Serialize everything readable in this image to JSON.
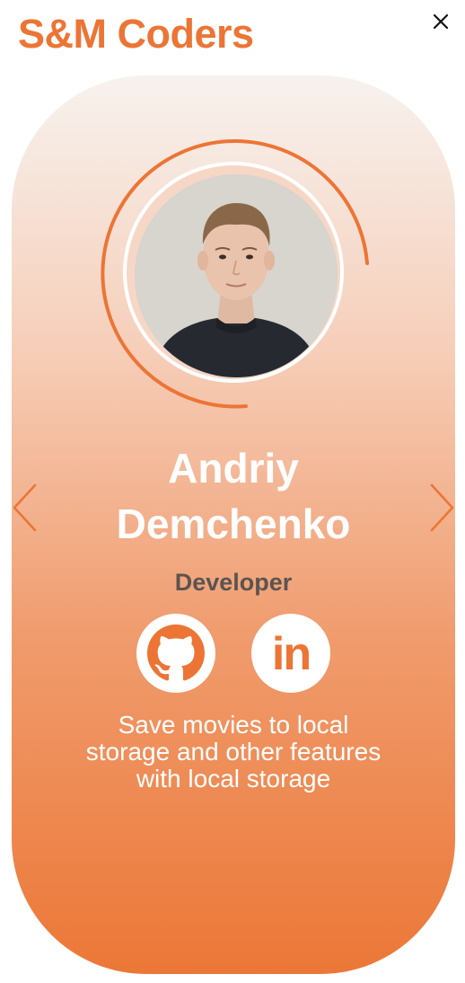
{
  "header": {
    "brand": "S&M Coders",
    "close_icon": "close-icon"
  },
  "card": {
    "name_line1": "Andriy",
    "name_line2": "Demchenko",
    "role": "Developer",
    "description": "Save movies to local storage and other features with local storage",
    "social": [
      {
        "icon": "github-icon"
      },
      {
        "icon": "linkedin-icon",
        "glyph": "in"
      }
    ],
    "nav": {
      "prev_icon": "chevron-left-icon",
      "next_icon": "chevron-right-icon"
    }
  },
  "colors": {
    "accent": "#ec7535",
    "card_top": "#f7f2ef",
    "card_bottom": "#ec7737",
    "role_text": "#5b5452",
    "white": "#ffffff"
  }
}
